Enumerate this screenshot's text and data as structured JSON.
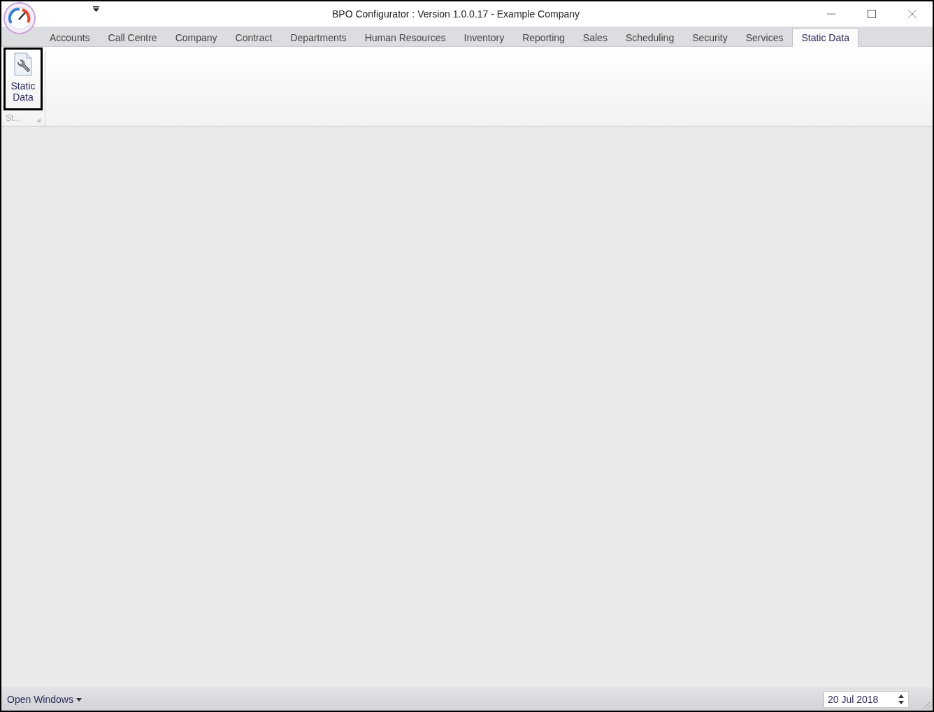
{
  "window": {
    "title": "BPO Configurator : Version 1.0.0.17 - Example Company"
  },
  "tabs": [
    {
      "label": "Accounts",
      "selected": false
    },
    {
      "label": "Call Centre",
      "selected": false
    },
    {
      "label": "Company",
      "selected": false
    },
    {
      "label": "Contract",
      "selected": false
    },
    {
      "label": "Departments",
      "selected": false
    },
    {
      "label": "Human Resources",
      "selected": false
    },
    {
      "label": "Inventory",
      "selected": false
    },
    {
      "label": "Reporting",
      "selected": false
    },
    {
      "label": "Sales",
      "selected": false
    },
    {
      "label": "Scheduling",
      "selected": false
    },
    {
      "label": "Security",
      "selected": false
    },
    {
      "label": "Services",
      "selected": false
    },
    {
      "label": "Static Data",
      "selected": true
    }
  ],
  "ribbon": {
    "groups": [
      {
        "caption": "St...",
        "buttons": [
          {
            "label": "Static Data",
            "selected": true
          }
        ]
      }
    ]
  },
  "status_bar": {
    "menu": "Open Windows",
    "date": "20 Jul 2018"
  }
}
